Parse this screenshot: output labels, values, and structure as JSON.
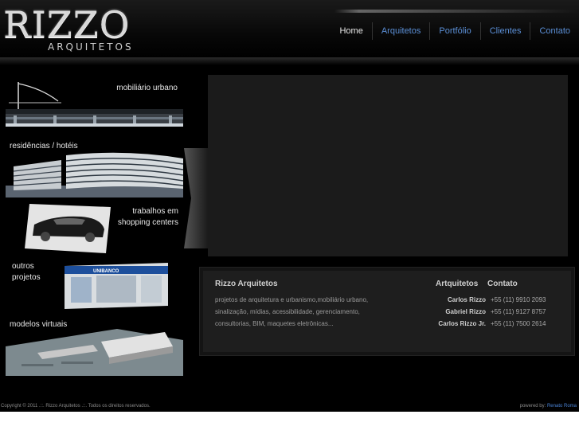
{
  "logo": {
    "main": "RIZZO",
    "sub": "ARQUITETOS"
  },
  "nav": [
    "Home",
    "Arquitetos",
    "Portfólio",
    "Clientes",
    "Contato"
  ],
  "categories": [
    {
      "label": "mobiliário urbano"
    },
    {
      "label": "residências / hotéis"
    },
    {
      "label": "trabalhos em\nshopping centers"
    },
    {
      "label": "outros\nprojetos",
      "sign": "UNIBANCO"
    },
    {
      "label": "modelos virtuais"
    }
  ],
  "about": {
    "title": "Rizzo Arquitetos",
    "description": "projetos de arquitetura e urbanismo,mobiliário urbano, sinalização, mídias, acessibilidade, gerenciamento, consultorias, BIM, maquetes eletrônicas..."
  },
  "contacts": {
    "header_architects": "Artquitetos",
    "header_contact": "Contato",
    "rows": [
      {
        "name": "Carlos Rizzo",
        "phone": "+55 (11) 9910 2093"
      },
      {
        "name": "Gabriel Rizzo",
        "phone": "+55 (11) 9127 8757"
      },
      {
        "name": "Carlos Rizzo Jr.",
        "phone": "+55 (11) 7500 2614"
      }
    ]
  },
  "footer": {
    "copyright": "Copyright © 2011 .::. Rizzo Arquitetos .::. Todos os direitos reservados.",
    "powered_by": "powered by:",
    "author": "Renato Roma"
  }
}
